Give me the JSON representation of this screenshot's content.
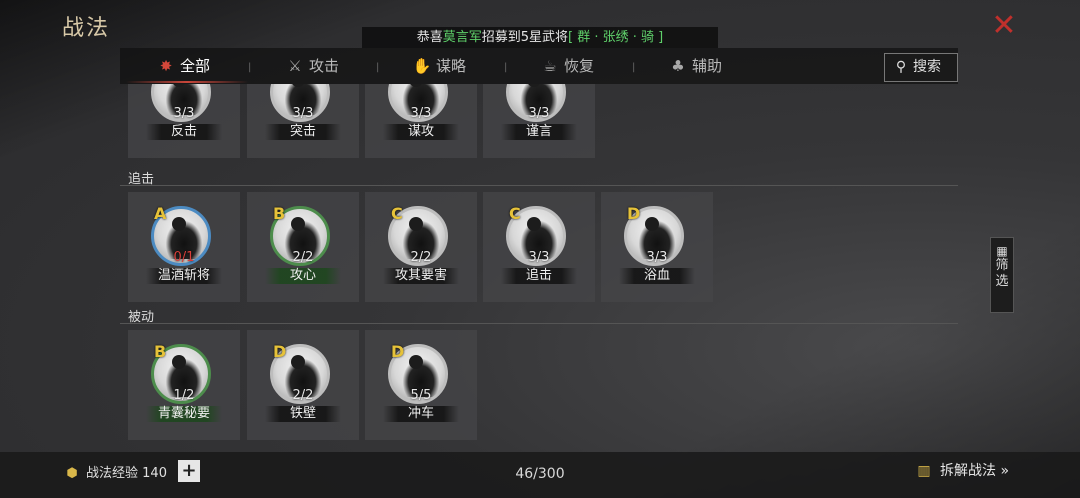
{
  "header": {
    "title": "战法",
    "close_icon": "close-icon"
  },
  "announcement": {
    "prefix": "恭喜",
    "name": "莫言军",
    "middle": "招募到5星武将",
    "tag": "[ 群 · 张绣 · 骑 ]"
  },
  "tabs": [
    {
      "label": "全部",
      "icon": "all-icon",
      "active": true
    },
    {
      "label": "攻击",
      "icon": "crossed-swords-icon",
      "active": false
    },
    {
      "label": "谋略",
      "icon": "strategy-icon",
      "active": false
    },
    {
      "label": "恢复",
      "icon": "recovery-icon",
      "active": false
    },
    {
      "label": "辅助",
      "icon": "support-icon",
      "active": false
    }
  ],
  "search": {
    "label": "搜索"
  },
  "sections": [
    {
      "label": "",
      "cards": [
        {
          "grade": "",
          "count": "3/3",
          "name": "反击",
          "ring": "gray"
        },
        {
          "grade": "",
          "count": "3/3",
          "name": "突击",
          "ring": "gray"
        },
        {
          "grade": "",
          "count": "3/3",
          "name": "谋攻",
          "ring": "gray"
        },
        {
          "grade": "",
          "count": "3/3",
          "name": "谨言",
          "ring": "gray"
        }
      ]
    },
    {
      "label": "追击",
      "cards": [
        {
          "grade": "A",
          "count": "0/1",
          "name": "温酒斩将",
          "ring": "A",
          "count_red": true
        },
        {
          "grade": "B",
          "count": "2/2",
          "name": "攻心",
          "ring": "B",
          "name_green": true
        },
        {
          "grade": "C",
          "count": "2/2",
          "name": "攻其要害",
          "ring": "gray"
        },
        {
          "grade": "C",
          "count": "3/3",
          "name": "追击",
          "ring": "gray"
        },
        {
          "grade": "D",
          "count": "3/3",
          "name": "浴血",
          "ring": "gray"
        }
      ]
    },
    {
      "label": "被动",
      "cards": [
        {
          "grade": "B",
          "count": "1/2",
          "name": "青囊秘要",
          "ring": "B",
          "name_green": true
        },
        {
          "grade": "D",
          "count": "2/2",
          "name": "铁壁",
          "ring": "gray"
        },
        {
          "grade": "D",
          "count": "5/5",
          "name": "冲车",
          "ring": "gray"
        }
      ]
    }
  ],
  "filter": {
    "label_line1": "筛",
    "label_line2": "选"
  },
  "footer": {
    "exp_label": "战法经验",
    "exp_value": "140",
    "capacity": "46/300",
    "decompose_label": "拆解战法 »"
  }
}
